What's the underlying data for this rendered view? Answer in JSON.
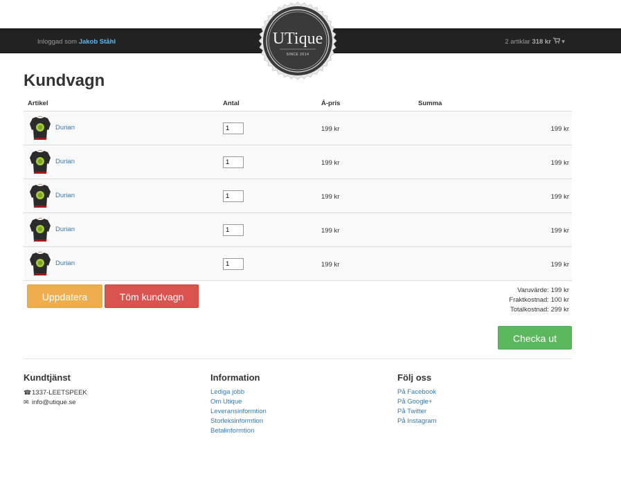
{
  "header": {
    "logged_prefix": "Inloggad som",
    "user_name": "Jakob Ståhl",
    "cart_count": "2 artiklar",
    "cart_amount": "318 kr",
    "cart_icon": "cart-icon",
    "cart_caret": "▾"
  },
  "logo": {
    "brand": "UTique",
    "since": "SINCE 2014"
  },
  "page_title": "Kundvagn",
  "table": {
    "headers": [
      "Artikel",
      "Antal",
      "Á-pris",
      "Summa"
    ],
    "rows": [
      {
        "name": "Durian",
        "qty": "1",
        "price": "199 kr",
        "sum": "199 kr"
      },
      {
        "name": "Durian",
        "qty": "1",
        "price": "199 kr",
        "sum": "199 kr"
      },
      {
        "name": "Durian",
        "qty": "1",
        "price": "199 kr",
        "sum": "199 kr"
      },
      {
        "name": "Durian",
        "qty": "1",
        "price": "199 kr",
        "sum": "199 kr"
      },
      {
        "name": "Durian",
        "qty": "1",
        "price": "199 kr",
        "sum": "199 kr"
      }
    ]
  },
  "buttons": {
    "update": "Uppdatera",
    "empty": "Töm kundvagn",
    "checkout": "Checka ut"
  },
  "totals": {
    "goods": "Varuvärde: 199 kr",
    "shipping": "Fraktkostnad: 100 kr",
    "total": "Totalkostnad: 299 kr"
  },
  "footer": {
    "support": {
      "title": "Kundtjänst",
      "phone": "1337-LEETSPEEK",
      "email": "info@utique.se",
      "phone_icon": "phone-icon",
      "email_icon": "envelope-icon"
    },
    "information": {
      "title": "Information",
      "links": [
        "Lediga jobb",
        "Om Utique",
        "Leveransinformtion",
        "Storleksinformtion",
        "Betalinformtion"
      ]
    },
    "follow": {
      "title": "Följ oss",
      "links": [
        "På Facebook",
        "På Google+",
        "På Twitter",
        "På Instagram"
      ]
    }
  },
  "colors": {
    "topbar": "#222222",
    "link": "#337ab7",
    "update": "#f0ad4e",
    "empty": "#d9534f",
    "checkout": "#5cb85c"
  }
}
